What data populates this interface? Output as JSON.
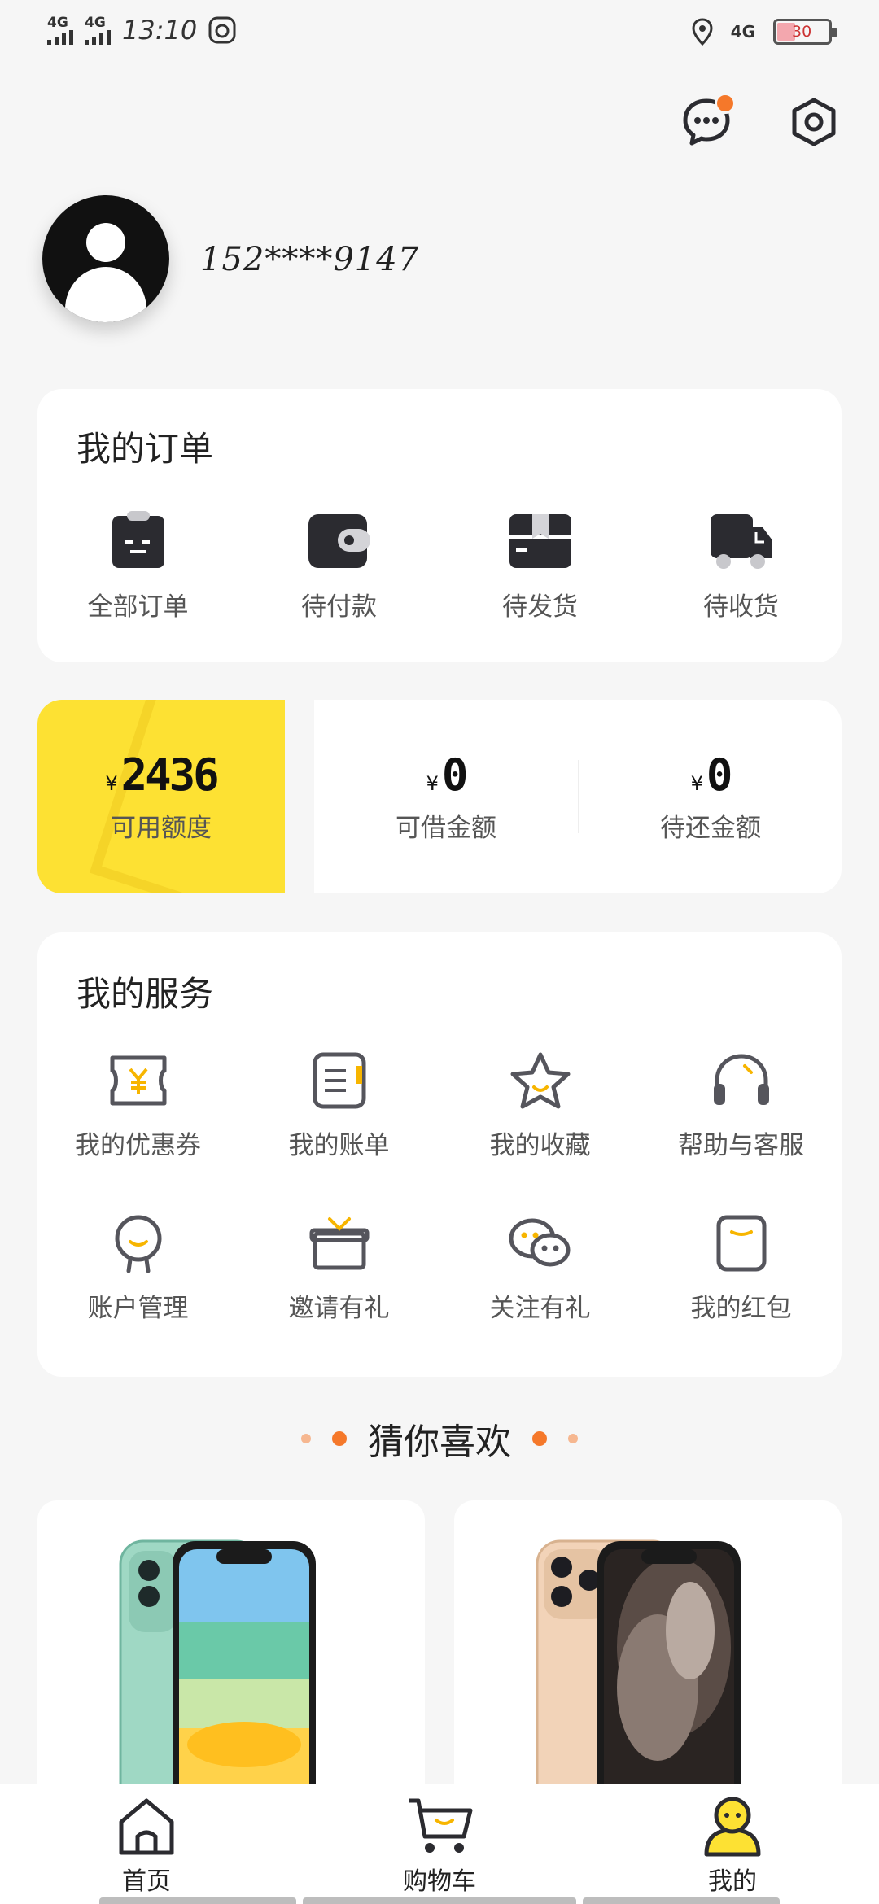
{
  "status_bar": {
    "network1": "4G",
    "network2": "4G",
    "time": "13:10",
    "network_right": "4G",
    "battery": "30"
  },
  "profile": {
    "phone": "152****9147"
  },
  "orders": {
    "title": "我的订单",
    "items": [
      {
        "label": "全部订单",
        "icon": "clipboard-icon"
      },
      {
        "label": "待付款",
        "icon": "wallet-icon"
      },
      {
        "label": "待发货",
        "icon": "package-icon"
      },
      {
        "label": "待收货",
        "icon": "truck-icon"
      }
    ]
  },
  "credit": {
    "currency": "¥",
    "available": {
      "amount": "2436",
      "label": "可用额度"
    },
    "borrowable": {
      "amount": "0",
      "label": "可借金额"
    },
    "to_repay": {
      "amount": "0",
      "label": "待还金额"
    }
  },
  "services": {
    "title": "我的服务",
    "items": [
      {
        "label": "我的优惠券",
        "icon": "coupon-icon"
      },
      {
        "label": "我的账单",
        "icon": "bill-icon"
      },
      {
        "label": "我的收藏",
        "icon": "star-icon"
      },
      {
        "label": "帮助与客服",
        "icon": "headset-icon"
      },
      {
        "label": "账户管理",
        "icon": "account-icon"
      },
      {
        "label": "邀请有礼",
        "icon": "gift-icon"
      },
      {
        "label": "关注有礼",
        "icon": "wechat-icon"
      },
      {
        "label": "我的红包",
        "icon": "red-packet-icon"
      }
    ]
  },
  "recommend": {
    "title": "猜你喜欢"
  },
  "bottom_nav": {
    "items": [
      {
        "label": "首页",
        "icon": "home-icon"
      },
      {
        "label": "购物车",
        "icon": "cart-icon"
      },
      {
        "label": "我的",
        "icon": "profile-icon"
      }
    ]
  },
  "colors": {
    "accent_yellow": "#fde133",
    "accent_orange": "#f5782a",
    "icon_dark": "#2b2b30",
    "icon_stroke": "#55555c"
  }
}
